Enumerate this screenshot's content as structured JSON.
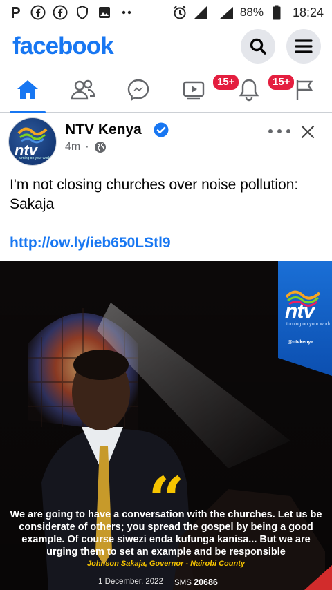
{
  "status_bar": {
    "left_icons": [
      "p-app-icon",
      "facebook-icon",
      "facebook-icon",
      "shield-icon",
      "gallery-icon",
      "dots-icon"
    ],
    "right_icons": [
      "alarm-icon",
      "signal-icon",
      "network-3g-icon",
      "battery-icon"
    ],
    "network": "3G",
    "battery": "88%",
    "time": "18:24"
  },
  "header": {
    "logo": "facebook",
    "search_icon": "search-icon",
    "menu_icon": "menu-icon",
    "brand_color": "#1877f2"
  },
  "nav": {
    "tabs": [
      {
        "icon": "home-icon",
        "active": true
      },
      {
        "icon": "friends-icon"
      },
      {
        "icon": "messenger-icon"
      },
      {
        "icon": "video-icon",
        "badge": "15+"
      },
      {
        "icon": "notifications-icon",
        "badge": "15+"
      },
      {
        "icon": "pages-flag-icon"
      }
    ]
  },
  "post": {
    "author": "NTV Kenya",
    "verified": true,
    "time": "4m",
    "separator": "·",
    "audience_icon": "globe-icon",
    "text": "I'm not closing churches over noise pollution: Sakaja",
    "link": "http://ow.ly/ieb650LStl9",
    "avatar": {
      "brand": "ntv",
      "tagline": "turning on your world"
    },
    "image": {
      "brand": "ntv",
      "tagline": "turning on your world",
      "handle": "@ntvkenya",
      "quote": "We are going to have a conversation with the churches. Let us be considerate of others; you spread the gospel by being a good example. Of course siwezi enda kufunga kanisa... But we are urging them to set an example and be responsible",
      "attribution": "Johnson Sakaja, Governor - Nairobi County",
      "date": "1 December, 2022",
      "sms_label": "SMS",
      "sms_number": "20686"
    }
  }
}
